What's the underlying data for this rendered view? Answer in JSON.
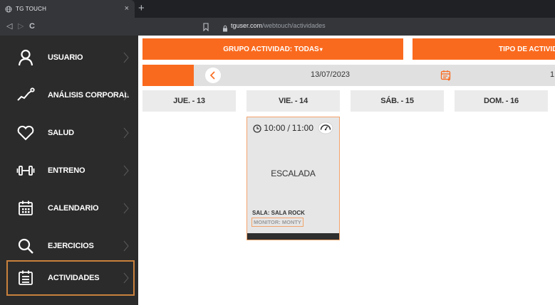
{
  "browser": {
    "tab_title": "TG TOUCH",
    "tab_close": "×",
    "new_tab": "+",
    "back": "◁",
    "forward": "▷",
    "reload": "C",
    "url_host": "tguser.com",
    "url_path": "/webtouch/actividades"
  },
  "sidebar": {
    "items": [
      {
        "label": "USUARIO",
        "icon": "user-icon"
      },
      {
        "label": "ANÁLISIS CORPORAL",
        "icon": "trend-icon"
      },
      {
        "label": "SALUD",
        "icon": "heart-icon"
      },
      {
        "label": "ENTRENO",
        "icon": "dumbbell-icon"
      },
      {
        "label": "CALENDARIO",
        "icon": "calendar-icon"
      },
      {
        "label": "EJERCICIOS",
        "icon": "search-icon"
      },
      {
        "label": "ACTIVIDADES",
        "icon": "activities-icon",
        "active": true
      }
    ]
  },
  "filters": {
    "group": "GRUPO ACTIVIDAD: TODAS",
    "group_caret": "▾",
    "type": "TIPO DE ACTIVIDA"
  },
  "datebar": {
    "date": "13/07/2023",
    "next_fragment": "1"
  },
  "days": [
    "JUE. - 13",
    "VIE. - 14",
    "SÁB. - 15",
    "DOM. - 16"
  ],
  "activity": {
    "time": "10:00 / 11:00",
    "title": "ESCALADA",
    "room": "SALA: SALA ROCK",
    "monitor": "MONITOR: MONTY"
  },
  "colors": {
    "accent": "#fa6a1e",
    "sidebar_bg": "#2b2b2b",
    "active_border": "#c9813d",
    "card_border": "#f2a36a"
  }
}
